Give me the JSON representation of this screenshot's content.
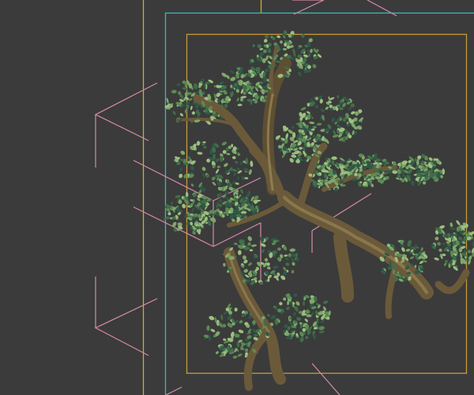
{
  "viewport": {
    "background": "#3b3b3b",
    "safe_frame_outer_color": "#c8b030",
    "safe_frame_action_color": "#3ab8c0",
    "safe_frame_title_color": "#c89a38",
    "bounding_bracket_color": "#d88aa8",
    "trunk_color": "#6b5a3a",
    "trunk_highlight": "#a08a5a",
    "leaf_colors": [
      "#3f6e4a",
      "#5c8a55",
      "#7fa76a",
      "#2f5a48",
      "#9cbf80"
    ]
  }
}
